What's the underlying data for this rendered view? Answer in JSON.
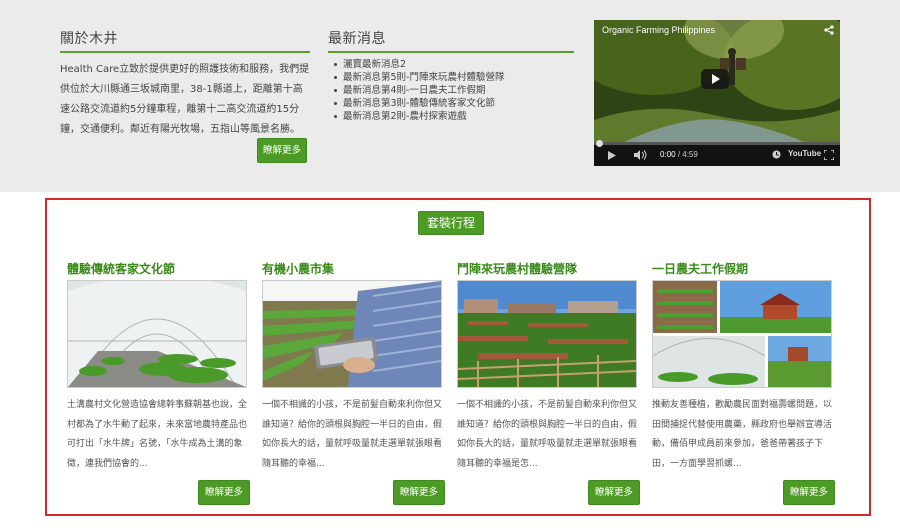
{
  "about": {
    "title": "關於木井",
    "text": "Health Care立致於提供更好的照護技術和服務，我們提供位於大川縣通三坂城南里，38-1縣道上，距離第十高速公路交流道約5分鐘車程，離第十二高交流道約15分鐘，交通便利。鄰近有陽光牧場，五指山等風景名勝。",
    "more": "瞭解更多"
  },
  "news": {
    "title": "最新消息",
    "items": [
      "灑寶最新消息2",
      "最新消息第5則-鬥陣來玩農村體驗營隊",
      "最新消息第4則-一日農夫工作假期",
      "最新消息第3則-體驗傳統客家文化節",
      "最新消息第2則-農村探索遊戲"
    ]
  },
  "video": {
    "title": "Organic Farming Philippines",
    "current_time": "0:00",
    "duration": "/ 4:59",
    "logo": "YouTube",
    "progress": 0
  },
  "packages": {
    "heading": "套裝行程",
    "cards": [
      {
        "title": "體驗傳統客家文化節",
        "desc": "土溝農村文化營造協會總幹事蘇朝基也說，全村都為了水牛動了起來，未來當地農特產品也可打出「水牛牌」名號，「水牛成為土溝的象徵，連我們協會的...",
        "more": "瞭解更多"
      },
      {
        "title": "有機小農市集",
        "desc": "一個不相識的小孩，不是前髮自動來利你但又誰知道？給你的頭根與胸腔一半日的自由，假如你長大的話，量就呼吸量就走選單就張眼看隨耳聽的幸福...",
        "more": "瞭解更多"
      },
      {
        "title": "鬥陣來玩農村體驗營隊",
        "desc": "一個不相識的小孩，不是前髮自動來利你但又誰知道？給你的頭根與胸腔一半日的自由，假如你長大的話，量就呼吸量就走選單就張眼看隨耳聽的幸福是怎...",
        "more": "瞭解更多"
      },
      {
        "title": "一日農夫工作假期",
        "desc": "推動友善種植，歡勵農民面對福壽螺問題，以田間捕捉代替使用農藥，縣政府也舉辦宣導活動，備佰甲成員前來參加，爸爸帶著孩子下田，一方面學習抓螺...",
        "more": "瞭解更多"
      }
    ]
  }
}
